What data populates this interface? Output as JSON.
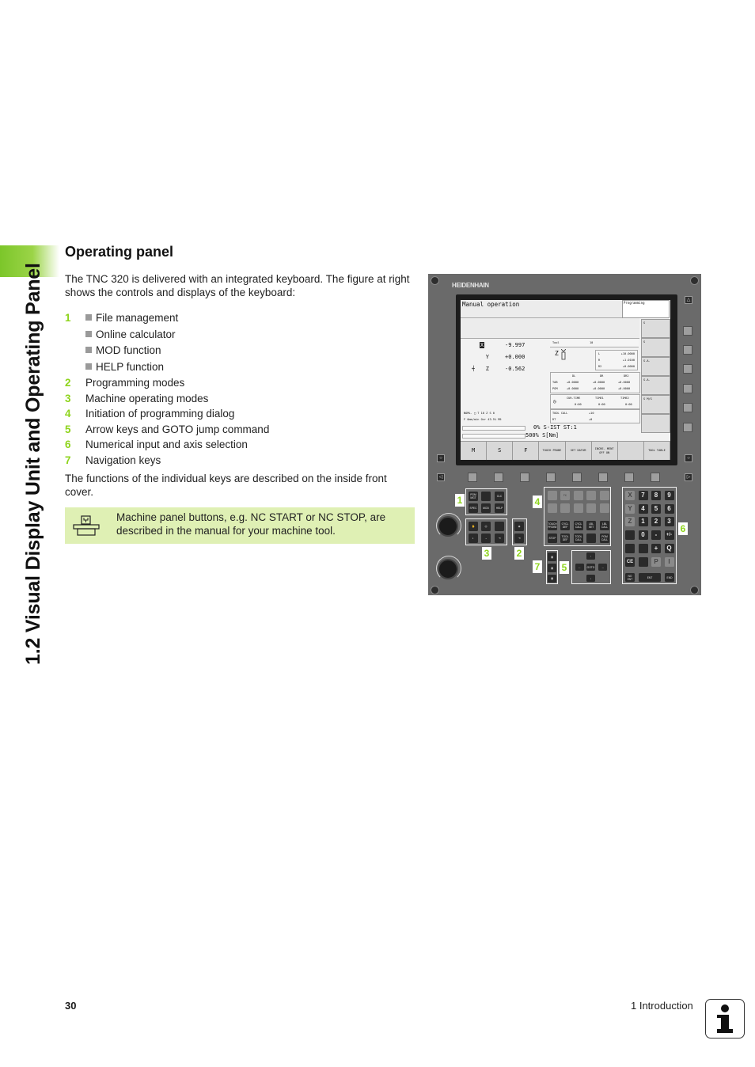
{
  "sidebar": {
    "section_title": "1.2 Visual Display Unit and Operating Panel"
  },
  "heading": "Operating panel",
  "intro": "The TNC 320 is delivered with an integrated keyboard. The figure at right shows the controls and displays of the keyboard:",
  "list": [
    {
      "num": "1",
      "subitems": [
        "File management",
        "Online calculator",
        "MOD function",
        "HELP function"
      ]
    },
    {
      "num": "2",
      "text": "Programming modes"
    },
    {
      "num": "3",
      "text": "Machine operating modes"
    },
    {
      "num": "4",
      "text": "Initiation of programming dialog"
    },
    {
      "num": "5",
      "text": "Arrow keys and GOTO jump command"
    },
    {
      "num": "6",
      "text": "Numerical input and axis selection"
    },
    {
      "num": "7",
      "text": "Navigation keys"
    }
  ],
  "para2": "The functions of the individual keys are described on the inside front cover.",
  "note": {
    "icon": "machine-tool-icon",
    "text": "Machine panel buttons, e.g. NC START or NC STOP, are described in the manual for your machine tool."
  },
  "footer": {
    "page_number": "30",
    "chapter": "1 Introduction",
    "icon": "info-icon"
  },
  "colors": {
    "accent_green": "#8ed41c",
    "note_bg": "#dff0b4"
  },
  "figure": {
    "brand": "HEIDENHAIN",
    "screen": {
      "mode_title": "Manual operation",
      "secondary_mode": "Programming",
      "positions": [
        {
          "axis": "X",
          "value": "-9.997"
        },
        {
          "axis": "Y",
          "value": "+0.000"
        },
        {
          "axis": "Z",
          "value": "-0.562"
        }
      ],
      "status_line1": "NOML.  □        T  10 Z S    0",
      "status_line2": "F   0mm/min   Ovr 43.5%    M5",
      "tool": {
        "label": "Tool",
        "number": "10",
        "axis": "Z",
        "L": "+10.0000",
        "R": "+1.0100",
        "R2": "+0.0000",
        "headers": [
          "DL",
          "DR",
          "DR2"
        ],
        "tab_label": "TAB",
        "tab_values": [
          "+0.0000",
          "+0.0000",
          "+0.0000"
        ],
        "pgm_label": "PGM",
        "pgm_values": [
          "+0.0000",
          "+0.0000",
          "+0.0000"
        ],
        "time_headers": [
          "CUR.TIME",
          "TIME1",
          "TIME2"
        ],
        "time_values": [
          "0:00",
          "0:00",
          "0:00"
        ],
        "tool_call_label": "TOOL CALL",
        "tool_call_value": "+10",
        "rt_label": "RT",
        "rt_value": "+0"
      },
      "bar1": "0% S-IST ST:1",
      "bar2": "500% S[Nm]",
      "softkeys": [
        "M",
        "S",
        "F",
        "TOUCH PROBE",
        "SET DATUM",
        "INCRE- MENT OFF ON",
        "",
        "TOOL TABLE"
      ],
      "vertical_softkeys": [
        "S",
        "S",
        "S.A.",
        "S.A.",
        "S M/S",
        ""
      ]
    },
    "callouts": [
      "1",
      "2",
      "3",
      "4",
      "5",
      "6",
      "7"
    ],
    "keys": {
      "group1": [
        "PGM MGT",
        "",
        "CLC",
        "SPEC",
        "MOD",
        "HELP"
      ],
      "group4_row3": [
        "TOUCH PROBE",
        "CYCL DEF",
        "CYCL CALL",
        "LBL SET",
        "LBL CALL"
      ],
      "group4_row4": [
        "STOP",
        "TOOL DEF",
        "TOOL CALL",
        "",
        "PGM CALL"
      ],
      "numpad": [
        [
          "X",
          "7",
          "8",
          "9"
        ],
        [
          "Y",
          "4",
          "5",
          "6"
        ],
        [
          "Z",
          "1",
          "2",
          "3"
        ],
        [
          "",
          "0",
          "-",
          "+/-"
        ],
        [
          "",
          "",
          "+",
          "Q"
        ],
        [
          "CE",
          "",
          "P",
          "I"
        ]
      ],
      "numpad_bottom": [
        "NO ENT",
        "ENT",
        "END"
      ],
      "goto": "GOTO"
    }
  }
}
